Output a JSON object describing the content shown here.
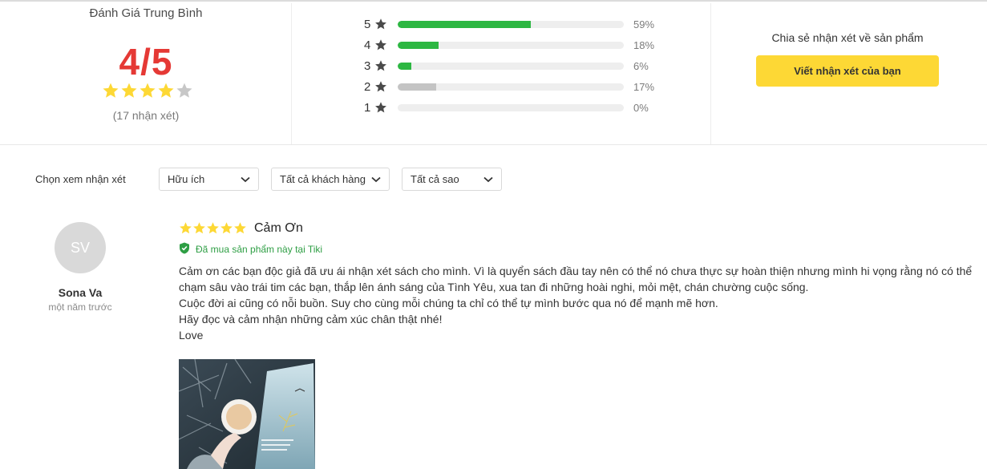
{
  "summary": {
    "title": "Đánh Giá Trung Bình",
    "score": "4/5",
    "rating_stars": 4,
    "max_stars": 5,
    "review_count": "(17 nhận xét)"
  },
  "distribution": [
    {
      "stars": "5",
      "percent_label": "59%",
      "percent": 59,
      "color": "#2db742"
    },
    {
      "stars": "4",
      "percent_label": "18%",
      "percent": 18,
      "color": "#2db742"
    },
    {
      "stars": "3",
      "percent_label": "6%",
      "percent": 6,
      "color": "#2db742"
    },
    {
      "stars": "2",
      "percent_label": "17%",
      "percent": 17,
      "color": "#c4c4c4"
    },
    {
      "stars": "1",
      "percent_label": "0%",
      "percent": 0,
      "color": "#c4c4c4"
    }
  ],
  "share": {
    "text": "Chia sẻ nhận xét về sản phẩm",
    "button_label": "Viết nhận xét của bạn"
  },
  "filters": {
    "label": "Chọn xem nhận xét",
    "sort": "Hữu ích",
    "customers": "Tất cả khách hàng",
    "stars": "Tất cả sao"
  },
  "review": {
    "user": {
      "initials": "SV",
      "name": "Sona Va",
      "time": "một năm trước"
    },
    "stars": 5,
    "title": "Cảm Ơn",
    "verified": "Đã mua sản phẩm này tại Tiki",
    "body": [
      "Cảm ơn các bạn độc giả đã ưu ái nhận xét sách cho mình. Vì là quyển sách đầu tay nên có thể nó chưa thực sự hoàn thiện nhưng mình hi vọng rằng nó có thể chạm sâu vào trái tim các bạn, thắp lên ánh sáng của Tình Yêu, xua tan đi những hoài nghi, mỏi mệt, chán chường cuộc sống.",
      "Cuộc đời ai cũng có nỗi buồn. Suy cho cùng mỗi chúng ta chỉ có thể tự mình bước qua nó để mạnh mẽ hơn.",
      "Hãy đọc và cảm nhận những cảm xúc chân thật nhé!",
      "Love"
    ]
  },
  "colors": {
    "star_yellow": "#fdd835",
    "star_gray": "#c7c7c7",
    "score_red": "#e53935",
    "bar_green": "#2db742",
    "button_yellow": "#fdd835",
    "verified_green": "#2e9e44"
  }
}
